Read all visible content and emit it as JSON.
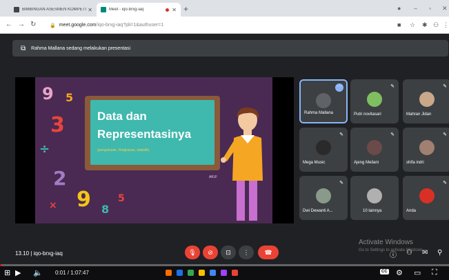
{
  "browser": {
    "tabs": [
      {
        "title": "BIMBINGAN ASESMEN KOMPETI",
        "close": "✕"
      },
      {
        "title": "Meet - iqo-brxg-iaq",
        "close": "✕"
      }
    ],
    "new_tab": "+",
    "url_host": "meet.google.com",
    "url_path": "/iqo-brxg-iaq?pli=1&authuser=1"
  },
  "meet": {
    "presentation_banner": "Rahma Mallana sedang melakukan presentasi",
    "slide": {
      "title_line1": "Data dan",
      "title_line2": "Representasinya",
      "subtitle": "(pengukuran, Ringkasan, statistik)",
      "character_label": "AKU!"
    },
    "participants": [
      {
        "name": "Rahma Mallana",
        "active": true,
        "avatar_color": "#5f6368"
      },
      {
        "name": "Putri novitasari",
        "active": false,
        "avatar_color": "#7fbf5f"
      },
      {
        "name": "Mahran Jidan",
        "active": false,
        "avatar_color": "#c9a98a"
      },
      {
        "name": "Mega Music",
        "active": false,
        "avatar_color": "#2a2a2a"
      },
      {
        "name": "Ajeng Meilani",
        "active": false,
        "avatar_color": "#6b4a4a"
      },
      {
        "name": "shifa indri",
        "active": false,
        "avatar_color": "#a08070"
      },
      {
        "name": "Dwi Dewanti A...",
        "active": false,
        "avatar_color": "#8a9a8a"
      },
      {
        "name": "10 lainnya",
        "active": false,
        "avatar_color": "#b0b0b0"
      },
      {
        "name": "Anda",
        "active": false,
        "avatar_color": "#d93025"
      }
    ],
    "time": "13.10",
    "meeting_code": "iqo-brxg-iaq",
    "watermark_title": "Activate Windows",
    "watermark_sub": "Go to Settings to activate Windows."
  },
  "player": {
    "current_time": "0:01",
    "duration": "1:07:47",
    "progress_fraction": 0.003,
    "cc_label": "CC"
  },
  "colors": {
    "accent": "#8ab4f8",
    "danger": "#ea4335",
    "board": "#3fb8ad",
    "slide_bg": "#4a2a52"
  }
}
